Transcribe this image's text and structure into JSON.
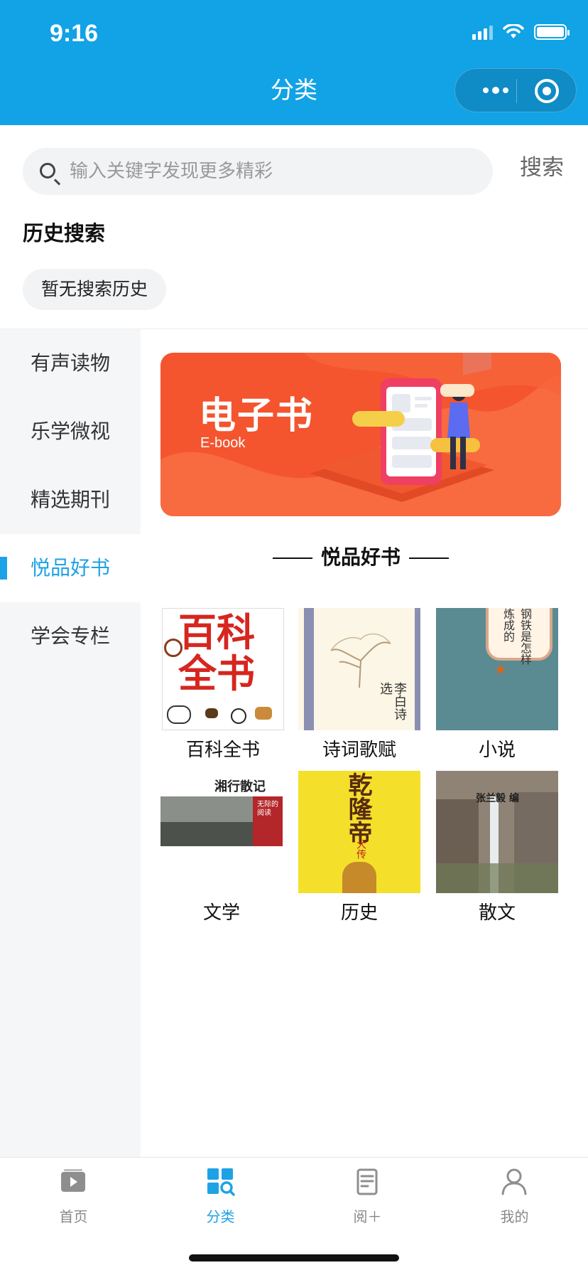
{
  "status_bar": {
    "time": "9:16"
  },
  "header": {
    "title": "分类"
  },
  "search": {
    "placeholder": "输入关键字发现更多精彩",
    "button_label": "搜索"
  },
  "history": {
    "title": "历史搜索",
    "empty_chip": "暂无搜索历史"
  },
  "sidebar": {
    "items": [
      {
        "label": "有声读物"
      },
      {
        "label": "乐学微视"
      },
      {
        "label": "精选期刊"
      },
      {
        "label": "悦品好书",
        "active": true
      },
      {
        "label": "学会专栏"
      }
    ]
  },
  "banner": {
    "title": "电子书",
    "subtitle": "E-book"
  },
  "section": {
    "title": "悦品好书"
  },
  "books": [
    {
      "label": "百科全书",
      "cover_text": [
        "百科",
        "全书"
      ]
    },
    {
      "label": "诗词歌赋",
      "cover_text": [
        "李白诗选"
      ]
    },
    {
      "label": "小说",
      "cover_text": [
        "钢铁是怎样",
        "炼成的"
      ]
    },
    {
      "label": "文学",
      "cover_text": [
        "湘行散记",
        "无际的阅读"
      ]
    },
    {
      "label": "历史",
      "cover_text": [
        "乾隆帝",
        "大传"
      ]
    },
    {
      "label": "散文",
      "cover_text": [
        "张兰毅 编"
      ]
    }
  ],
  "tabbar": {
    "items": [
      {
        "label": "首页",
        "icon": "home-video-icon"
      },
      {
        "label": "分类",
        "icon": "category-grid-icon",
        "active": true
      },
      {
        "label": "阅＋",
        "icon": "document-icon"
      },
      {
        "label": "我的",
        "icon": "person-icon"
      }
    ]
  },
  "colors": {
    "accent": "#1ea2e6",
    "header_bg": "#12a2e6",
    "banner_bg": "#f4542e"
  }
}
